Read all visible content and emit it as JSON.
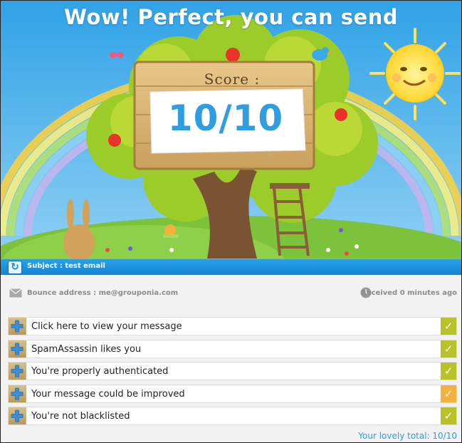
{
  "hero": {
    "title": "Wow! Perfect, you can send",
    "score_label": "Score :",
    "score_value": "10/10"
  },
  "subject": {
    "text": "Subject : test email"
  },
  "info": {
    "bounce": "Bounce address : me@grouponia.com",
    "received": "Received 0 minutes ago"
  },
  "results": [
    {
      "label": "Click here to view your message",
      "status": "ok",
      "icon": "check-icon"
    },
    {
      "label": "SpamAssassin likes you",
      "status": "ok",
      "icon": "check-icon"
    },
    {
      "label": "You're properly authenticated",
      "status": "ok",
      "icon": "check-icon"
    },
    {
      "label": "Your message could be improved",
      "status": "warn",
      "icon": "check-icon"
    },
    {
      "label": "You're not blacklisted",
      "status": "ok",
      "icon": "check-icon"
    }
  ],
  "total": "Your lovely total: 10/10",
  "colors": {
    "accent_blue": "#2f9ee0",
    "ok_green": "#b8c32a",
    "warn_orange": "#f4b23c",
    "plus_tan": "#c9ad72"
  }
}
